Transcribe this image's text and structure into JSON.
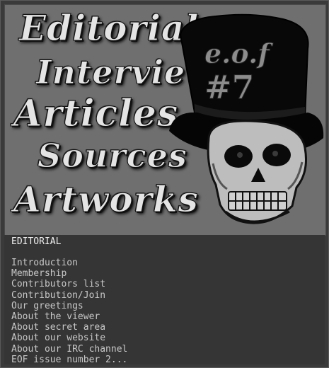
{
  "banner": {
    "nav": [
      {
        "label": "Editorial"
      },
      {
        "label": "Interviews"
      },
      {
        "label": "Articles"
      },
      {
        "label": "Sources"
      },
      {
        "label": "Artworks"
      }
    ],
    "logo": {
      "hat_text": "e.o.f",
      "hat_number": "#7",
      "icon": "skull-top-hat-icon"
    }
  },
  "content": {
    "heading": "EDITORIAL",
    "items": [
      "Introduction",
      "Membership",
      "Contributors list",
      "Contribution/Join",
      "Our greetings",
      "About the viewer",
      "About secret area",
      "About our website",
      "About our IRC channel",
      "EOF issue number 2..."
    ]
  },
  "colors": {
    "banner_bg": "#6f6f6f",
    "content_bg": "#353535",
    "text": "#c8c8c8"
  }
}
